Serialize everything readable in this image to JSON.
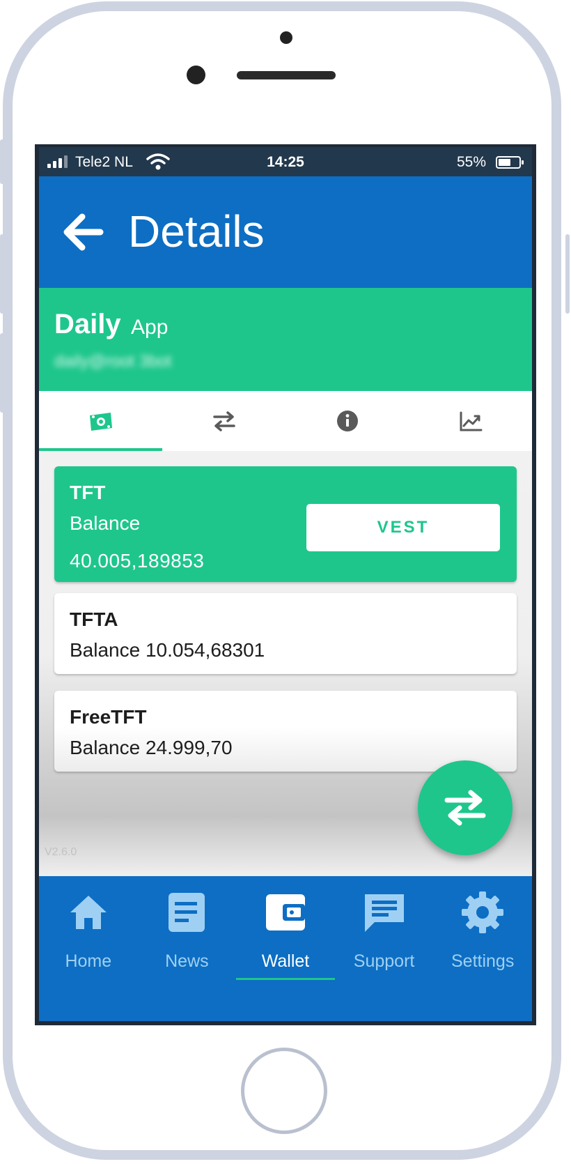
{
  "status_bar": {
    "carrier": "Tele2 NL",
    "time": "14:25",
    "battery": "55%"
  },
  "app_bar": {
    "title": "Details",
    "back_icon": "arrow-left-icon"
  },
  "account": {
    "name": "Daily",
    "type": "App",
    "address_blurred": "daily@root 3bot"
  },
  "tabs": [
    {
      "icon": "money-icon",
      "active": true
    },
    {
      "icon": "transfer-icon",
      "active": false
    },
    {
      "icon": "info-icon",
      "active": false
    },
    {
      "icon": "chart-icon",
      "active": false
    }
  ],
  "balances": {
    "tft": {
      "title": "TFT",
      "label": "Balance",
      "value": "40.005,189853",
      "action": "VEST"
    },
    "tfta": {
      "title": "TFTA",
      "line": "Balance 10.054,68301"
    },
    "freetft": {
      "title": "FreeTFT",
      "line": "Balance 24.999,70"
    }
  },
  "version": "V2.6.0",
  "fab_icon": "transfer-icon",
  "bottom_nav": [
    {
      "label": "Home",
      "icon": "home-icon",
      "active": false
    },
    {
      "label": "News",
      "icon": "news-icon",
      "active": false
    },
    {
      "label": "Wallet",
      "icon": "wallet-icon",
      "active": true
    },
    {
      "label": "Support",
      "icon": "chat-icon",
      "active": false
    },
    {
      "label": "Settings",
      "icon": "gear-icon",
      "active": false
    }
  ],
  "colors": {
    "primary_blue": "#0d6ec3",
    "accent_green": "#1ec68c",
    "status_bar": "#22384d"
  }
}
